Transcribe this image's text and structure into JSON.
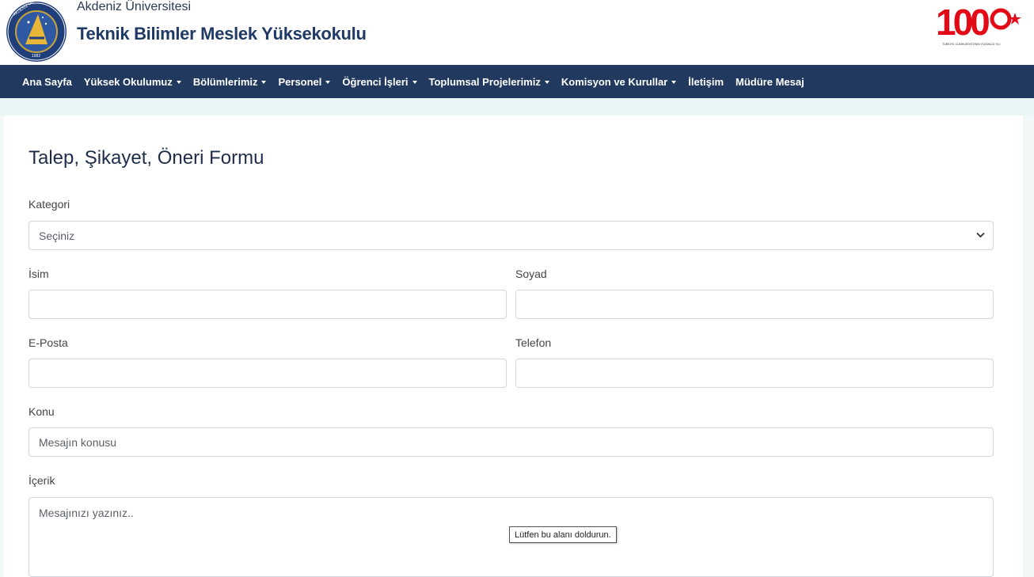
{
  "header": {
    "university": "Akdeniz Üniversitesi",
    "school": "Teknik Bilimler Meslek Yüksekokulu",
    "logo_text": "AKDENİZ ÜNİVERSİTESİ",
    "logo_year": "1982",
    "centennial_badge": "100",
    "centennial_caption": "TÜRKİYE CUMHURİYETİNİN YÜZÜNCÜ YILI"
  },
  "nav": {
    "items": [
      {
        "label": "Ana Sayfa",
        "dropdown": false
      },
      {
        "label": "Yüksek Okulumuz",
        "dropdown": true
      },
      {
        "label": "Bölümlerimiz",
        "dropdown": true
      },
      {
        "label": "Personel",
        "dropdown": true
      },
      {
        "label": "Öğrenci İşleri",
        "dropdown": true
      },
      {
        "label": "Toplumsal Projelerimiz",
        "dropdown": true
      },
      {
        "label": "Komisyon ve Kurullar",
        "dropdown": true
      },
      {
        "label": "İletişim",
        "dropdown": false
      },
      {
        "label": "Müdüre Mesaj",
        "dropdown": false
      }
    ]
  },
  "form": {
    "title": "Talep, Şikayet, Öneri Formu",
    "category_label": "Kategori",
    "category_value": "Seçiniz",
    "first_name_label": "İsim",
    "first_name_value": "",
    "last_name_label": "Soyad",
    "last_name_value": "",
    "email_label": "E-Posta",
    "email_value": "",
    "phone_label": "Telefon",
    "phone_value": "",
    "subject_label": "Konu",
    "subject_placeholder": "Mesajın konusu",
    "content_label": "İçerik",
    "content_placeholder": "Mesajınızı yazınız.."
  },
  "validation": {
    "tooltip": "Lütfen bu alanı doldurun."
  },
  "colors": {
    "navbar": "#21395f",
    "title": "#1f2d4a",
    "badge_red": "#e30a17"
  }
}
